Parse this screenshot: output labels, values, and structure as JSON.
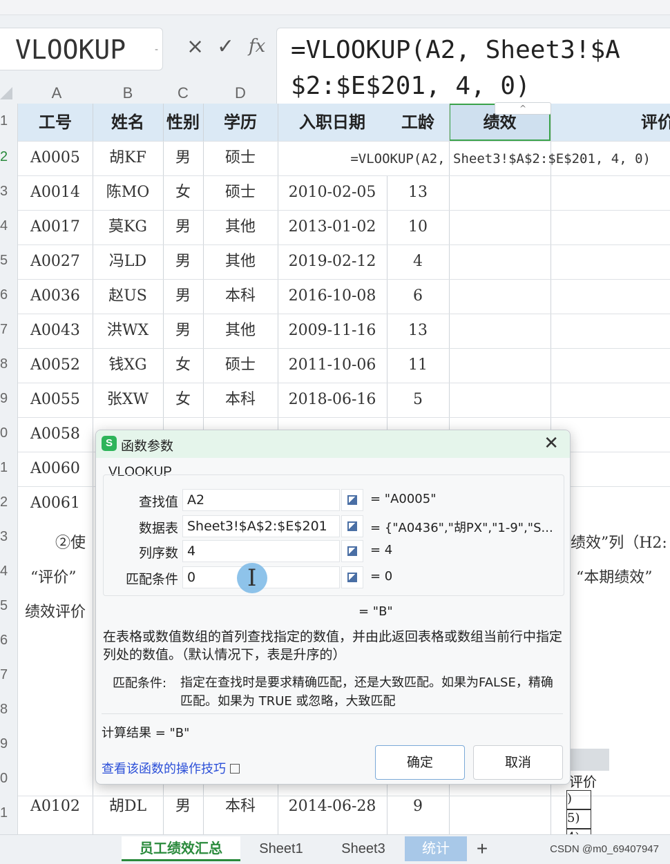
{
  "formula_bar": {
    "name_box": "VLOOKUP",
    "name_box_caret": "-",
    "cancel": "×",
    "confirm": "✓",
    "fx": "fx",
    "formula": "=VLOOKUP(A2, Sheet3!$A$2:$E$201, 4, 0)",
    "collapse": "^"
  },
  "columns": [
    "A",
    "B",
    "C",
    "D"
  ],
  "header": [
    "工号",
    "姓名",
    "性别",
    "学历",
    "入职日期",
    "工龄",
    "绩效",
    "评价"
  ],
  "row_numbers": [
    "1",
    "2",
    "3",
    "4",
    "5",
    "6",
    "7",
    "8",
    "9",
    "0",
    "1",
    "2",
    "3",
    "4",
    "5",
    "6",
    "7",
    "8",
    "9",
    "0",
    "1"
  ],
  "edit_row": {
    "id": "A0005",
    "name": "胡KF",
    "gender": "男",
    "edu": "硕士",
    "formula": "=VLOOKUP(A2, Sheet3!$A$2:$E$201, 4, 0)"
  },
  "rows": [
    {
      "id": "A0014",
      "name": "陈MO",
      "gender": "女",
      "edu": "硕士",
      "date": "2010-02-05",
      "years": "13"
    },
    {
      "id": "A0017",
      "name": "莫KG",
      "gender": "男",
      "edu": "其他",
      "date": "2013-01-02",
      "years": "10"
    },
    {
      "id": "A0027",
      "name": "冯LD",
      "gender": "男",
      "edu": "其他",
      "date": "2019-02-12",
      "years": "4"
    },
    {
      "id": "A0036",
      "name": "赵US",
      "gender": "男",
      "edu": "本科",
      "date": "2016-10-08",
      "years": "6"
    },
    {
      "id": "A0043",
      "name": "洪WX",
      "gender": "男",
      "edu": "其他",
      "date": "2009-11-16",
      "years": "13"
    },
    {
      "id": "A0052",
      "name": "钱XG",
      "gender": "女",
      "edu": "硕士",
      "date": "2011-10-06",
      "years": "11"
    },
    {
      "id": "A0055",
      "name": "张XW",
      "gender": "女",
      "edu": "本科",
      "date": "2018-06-16",
      "years": "5"
    }
  ],
  "partial_ids": [
    "A0058",
    "A0060",
    "A0061"
  ],
  "partial_last": {
    "id": "A0102",
    "name": "胡DL",
    "gender": "男",
    "edu": "本科",
    "date": "2014-06-28",
    "years": "9"
  },
  "background_text": {
    "line1_left": "②使",
    "line1_right": "绩效”列（H2:",
    "line2_left": "“评价”",
    "line2_right": "“本期绩效”",
    "line3_left": "绩效评价",
    "mini_header": "评价",
    "mini_rows": [
      ")",
      "5)",
      "4)",
      ""
    ]
  },
  "dialog": {
    "title": "函数参数",
    "logo": "S",
    "close": "✕",
    "function_name": "VLOOKUP",
    "args": [
      {
        "label": "查找值",
        "value": "A2",
        "result": "= \"A0005\""
      },
      {
        "label": "数据表",
        "value": "Sheet3!$A$2:$E$201",
        "result": "= {\"A0436\",\"胡PX\",\"1-9\",\"S..."
      },
      {
        "label": "列序数",
        "value": "4",
        "result": "= 4"
      },
      {
        "label": "匹配条件",
        "value": "0",
        "result": "= 0"
      }
    ],
    "formula_result": "= \"B\"",
    "description": "在表格或数值数组的首列查找指定的数值，并由此返回表格或数组当前行中指定列处的数值。（默认情况下，表是升序的）",
    "param_label": "匹配条件:",
    "param_desc": "指定在查找时是要求精确匹配，还是大致匹配。如果为FALSE，精确匹配。如果为 TRUE 或忽略，大致匹配",
    "calc_result": "计算结果 = \"B\"",
    "help_link": "查看该函数的操作技巧",
    "ok": "确定",
    "cancel": "取消"
  },
  "sheet_tabs": [
    "员工绩效汇总",
    "Sheet1",
    "Sheet3",
    "统计"
  ],
  "add_sheet": "+",
  "watermark": "CSDN @m0_69407947"
}
